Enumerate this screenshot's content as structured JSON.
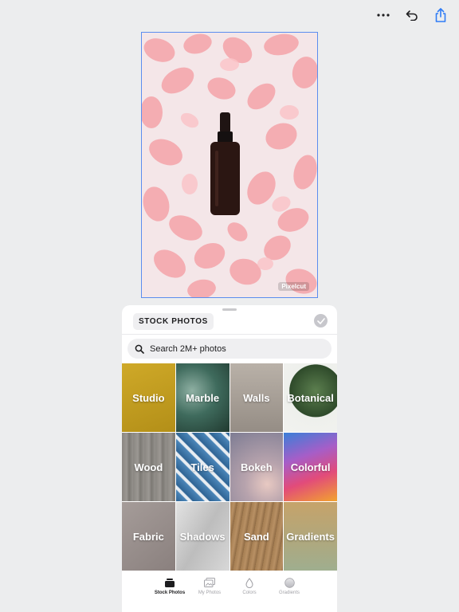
{
  "toolbar": {
    "more_icon": "ellipsis-icon",
    "undo_icon": "undo-icon",
    "share_icon": "share-icon",
    "accent": "#2f7cf6"
  },
  "canvas": {
    "watermark": "Pixelcut",
    "selection_color": "#5b8def"
  },
  "sheet": {
    "title": "STOCK PHOTOS",
    "search_placeholder": "Search 2M+ photos",
    "categories": [
      {
        "label": "Studio",
        "color": "#c29d1f"
      },
      {
        "label": "Marble",
        "color": "#3f6b5d"
      },
      {
        "label": "Walls",
        "color": "#a8a19a"
      },
      {
        "label": "Botanical",
        "color": "#3b5a35"
      },
      {
        "label": "Wood",
        "color": "#8e8b86"
      },
      {
        "label": "Tiles",
        "color": "#3e6f9a"
      },
      {
        "label": "Bokeh",
        "color": "#a69aa6"
      },
      {
        "label": "Colorful",
        "color": "#d74b8a"
      },
      {
        "label": "Fabric",
        "color": "#9a8f8d"
      },
      {
        "label": "Shadows",
        "color": "#cfcfcf"
      },
      {
        "label": "Sand",
        "color": "#a47e54"
      },
      {
        "label": "Gradients",
        "color": "#b5a57a"
      }
    ]
  },
  "tabs": [
    {
      "label": "Stock Photos",
      "icon": "stock-photos-icon",
      "active": true
    },
    {
      "label": "My Photos",
      "icon": "my-photos-icon",
      "active": false
    },
    {
      "label": "Colors",
      "icon": "drop-icon",
      "active": false
    },
    {
      "label": "Gradients",
      "icon": "gradient-circle-icon",
      "active": false
    }
  ]
}
